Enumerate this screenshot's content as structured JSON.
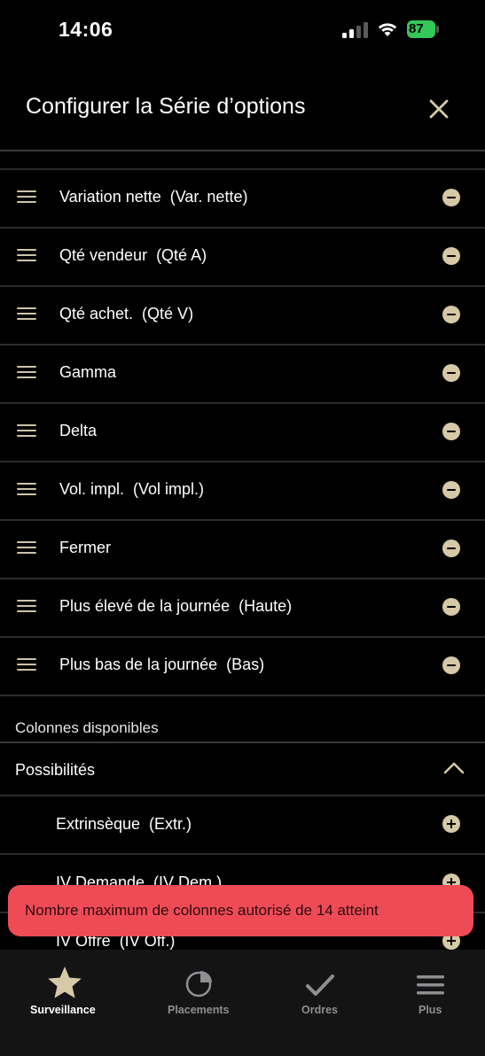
{
  "status_bar": {
    "time": "14:06",
    "battery": "87"
  },
  "header": {
    "title": "Configurer la Série d’options"
  },
  "selected_columns": [
    "Variation nette  (Var. nette)",
    "Qté vendeur  (Qté A)",
    "Qté achet.  (Qté V)",
    "Gamma",
    "Delta",
    "Vol. impl.  (Vol impl.)",
    "Fermer",
    "Plus élevé de la journée  (Haute)",
    "Plus bas de la journée  (Bas)"
  ],
  "available": {
    "section_label": "Colonnes disponibles",
    "group_label": "Possibilités",
    "items": [
      "Extrinsèque  (Extr.)",
      "IV Demande  (IV Dem.)",
      "IV Offre  (IV Off.)"
    ]
  },
  "toast": {
    "message": "Nombre maximum de colonnes autorisé de 14 atteint"
  },
  "tab_bar": {
    "tabs": [
      {
        "label": "Surveillance",
        "icon": "star-icon",
        "active": true
      },
      {
        "label": "Placements",
        "icon": "pie-chart-icon",
        "active": false
      },
      {
        "label": "Ordres",
        "icon": "checkmark-icon",
        "active": false
      },
      {
        "label": "Plus",
        "icon": "menu-icon",
        "active": false
      }
    ]
  },
  "colors": {
    "accent": "#d6c9a7",
    "toast_background": "#ef4b57",
    "battery": "#34c759",
    "tab_inactive": "#8e8e93"
  }
}
